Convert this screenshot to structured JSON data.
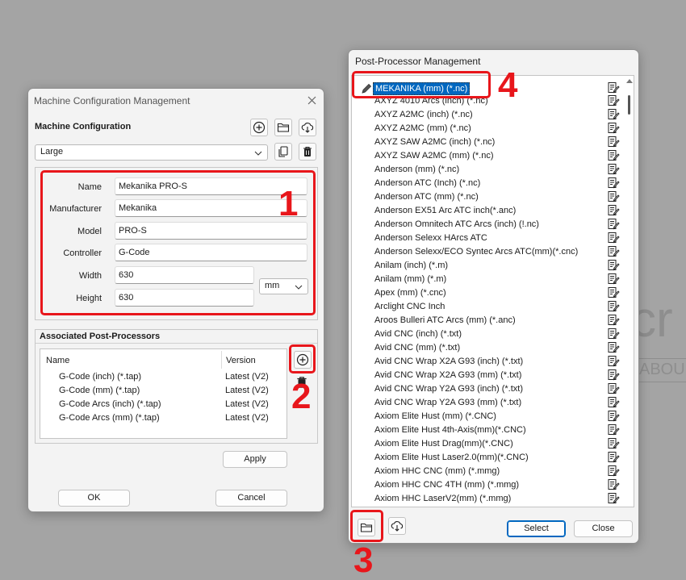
{
  "machine_dialog": {
    "title": "Machine Configuration Management",
    "section_label": "Machine Configuration",
    "selected_machine": "Large",
    "fields": {
      "name_label": "Name",
      "name_value": "Mekanika PRO-S",
      "manufacturer_label": "Manufacturer",
      "manufacturer_value": "Mekanika",
      "model_label": "Model",
      "model_value": "PRO-S",
      "controller_label": "Controller",
      "controller_value": "G-Code",
      "width_label": "Width",
      "width_value": "630",
      "height_label": "Height",
      "height_value": "630",
      "unit": "mm"
    },
    "assoc": {
      "title": "Associated Post-Processors",
      "col_name": "Name",
      "col_version": "Version",
      "rows": [
        {
          "name": "G-Code (inch) (*.tap)",
          "version": "Latest (V2)"
        },
        {
          "name": "G-Code (mm) (*.tap)",
          "version": "Latest (V2)"
        },
        {
          "name": "G-Code Arcs (inch) (*.tap)",
          "version": "Latest (V2)"
        },
        {
          "name": "G-Code Arcs (mm) (*.tap)",
          "version": "Latest (V2)"
        }
      ]
    },
    "apply_label": "Apply",
    "ok_label": "OK",
    "cancel_label": "Cancel"
  },
  "pp_dialog": {
    "title": "Post-Processor Management",
    "selected_item": "MEKANIKA (mm) (*.nc)",
    "items": [
      "AXYZ 4010 Arcs (inch) (*.nc)",
      "AXYZ A2MC (inch) (*.nc)",
      "AXYZ A2MC (mm) (*.nc)",
      "AXYZ SAW A2MC (inch) (*.nc)",
      "AXYZ SAW A2MC (mm) (*.nc)",
      "Anderson (mm) (*.nc)",
      "Anderson ATC (Inch) (*.nc)",
      "Anderson ATC (mm) (*.nc)",
      "Anderson EX51 Arc ATC inch(*.anc)",
      "Anderson Omnitech ATC Arcs (inch) (!.nc)",
      "Anderson Selexx HArcs ATC",
      "Anderson Selexx/ECO Syntec Arcs ATC(mm)(*.cnc)",
      "Anilam (inch) (*.m)",
      "Anilam (mm) (*.m)",
      "Apex (mm) (*.cnc)",
      "Arclight CNC Inch",
      "Aroos Bulleri ATC Arcs (mm) (*.anc)",
      "Avid CNC (inch) (*.txt)",
      "Avid CNC (mm) (*.txt)",
      "Avid CNC Wrap X2A G93 (inch) (*.txt)",
      "Avid CNC Wrap X2A G93 (mm) (*.txt)",
      "Avid CNC Wrap Y2A G93 (inch) (*.txt)",
      "Avid CNC Wrap Y2A G93 (mm)  (*.txt)",
      "Axiom Elite Hust (mm) (*.CNC)",
      "Axiom Elite Hust 4th-Axis(mm)(*.CNC)",
      "Axiom Elite Hust Drag(mm)(*.CNC)",
      "Axiom Elite Hust Laser2.0(mm)(*.CNC)",
      "Axiom HHC CNC (mm) (*.mmg)",
      "Axiom HHC CNC 4TH (mm) (*.mmg)",
      "Axiom HHC LaserV2(mm) (*.mmg)"
    ],
    "select_label": "Select",
    "close_label": "Close"
  },
  "annotations": [
    "1",
    "2",
    "3",
    "4"
  ],
  "background_text": {
    "line1": "cr",
    "line2": "ABOU"
  },
  "colors": {
    "annotation_red": "#e8161b",
    "selection_blue": "#0067c0",
    "window_bg": "#f3f3f3",
    "desktop_bg": "#a4a4a4"
  }
}
